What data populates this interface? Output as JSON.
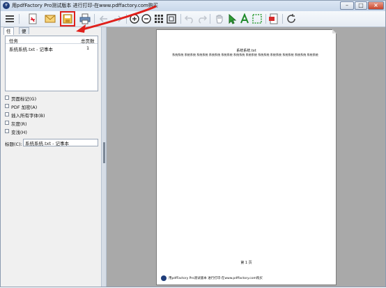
{
  "window": {
    "title": "用pdfFactory Pro测试版本 进行打印-在www.pdffactory.com购买",
    "icon": "pdffactory-app-icon"
  },
  "toolbar": {
    "buttons": [
      "menu-icon",
      "pdf-file-icon",
      "email-icon",
      "save-icon",
      "print-icon",
      "back-arrow-icon",
      "forward-arrow-icon",
      "zoom-in-icon",
      "zoom-out-icon",
      "thumbnails-icon",
      "fit-page-icon",
      "undo-icon",
      "redo-icon",
      "hand-icon",
      "select-arrow-icon",
      "text-icon",
      "marquee-icon",
      "bookmark-icon",
      "refresh-icon"
    ],
    "highlighted": "save-icon",
    "highlight_color": "#e0201b"
  },
  "left_panel": {
    "tabs": [
      {
        "label": "任务",
        "active": true
      },
      {
        "label": "便笺",
        "active": false
      }
    ],
    "task_table": {
      "headers": [
        "任务",
        "总页数"
      ],
      "rows": [
        {
          "name": "系统系统.txt - 记事本",
          "pages": "1"
        }
      ]
    },
    "options": [
      {
        "label": "页面标记(G)",
        "checked": false
      },
      {
        "label": "PDF 加密(A)",
        "checked": false
      },
      {
        "label": "插入所有字体(B)",
        "checked": false
      },
      {
        "label": "灰度(R)",
        "checked": false
      },
      {
        "label": "变浅(H)",
        "checked": false
      }
    ],
    "title_field": {
      "label": "标题(C):",
      "value": "系统系统.txt - 记事本"
    }
  },
  "preview": {
    "doc_title": "系统系统.txt",
    "doc_line": "系统系统 系统系统 系统系统 系统系统 系统系统 系统系统 系统系统 系统系统 系统系统 系统系统 系统系统 系统系统",
    "page_number": "第 1 页",
    "footer": "用pdfFactory Pro测试版本 进行打印-在www.pdffactory.com购买"
  },
  "colors": {
    "accent": "#e0201b",
    "preview_bg": "#a9a9a9",
    "panel_bg": "#f0f0f0"
  }
}
